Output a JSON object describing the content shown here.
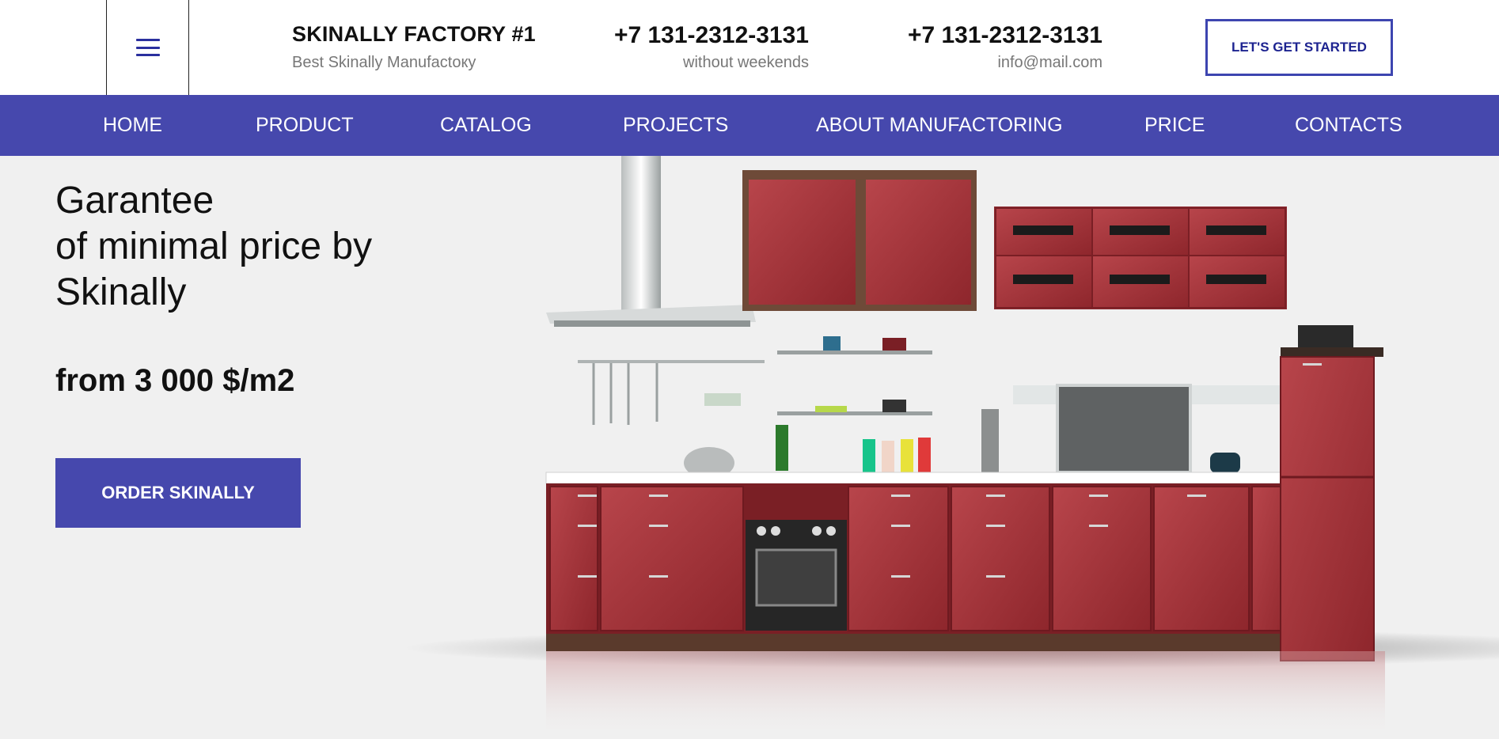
{
  "header": {
    "brand_title": "SKINALLY FACTORY #1",
    "brand_subtitle": "Best Skinally Manufactoку",
    "contact_1": {
      "phone": "+7 131-2312-3131",
      "note": "without weekends"
    },
    "contact_2": {
      "phone": "+7 131-2312-3131",
      "email": "info@mail.com"
    },
    "cta_label": "LET'S GET STARTED",
    "menu_icon": "hamburger-menu-icon"
  },
  "nav": {
    "items": [
      "HOME",
      "PRODUCT",
      "CATALOG",
      "PROJECTS",
      "ABOUT MANUFACTORING",
      "PRICE",
      "CONTACTS"
    ]
  },
  "hero": {
    "title_lines": [
      "Garantee",
      "of minimal price by",
      "Skinally"
    ],
    "price": "from 3 000 $/m2",
    "button_label": "ORDER SKINALLY",
    "image": "red-kitchen-set-illustration"
  },
  "colors": {
    "brand": "#4648ad",
    "brand_dark": "#1d2390",
    "hero_bg": "#f0f0f0",
    "cabinet_red": "#a8333a"
  }
}
